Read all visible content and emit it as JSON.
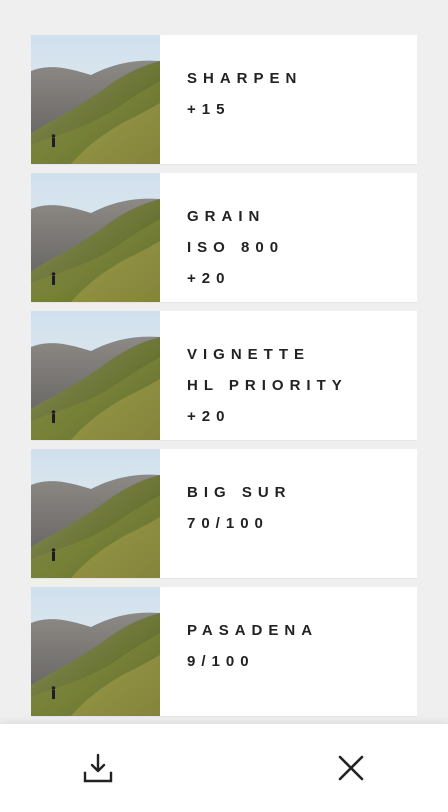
{
  "cards": [
    {
      "lines": [
        "SHARPEN",
        "+15"
      ]
    },
    {
      "lines": [
        "GRAIN",
        "ISO 800",
        "+20"
      ]
    },
    {
      "lines": [
        "VIGNETTE",
        "HL PRIORITY",
        "+20"
      ]
    },
    {
      "lines": [
        "BIG SUR",
        "70/100"
      ]
    },
    {
      "lines": [
        "PASADENA",
        "9/100"
      ]
    }
  ],
  "toolbar": {
    "download_icon": "download-icon",
    "close_icon": "close-icon"
  },
  "colors": {
    "background": "#efefef",
    "card": "#ffffff",
    "text": "#222222"
  }
}
